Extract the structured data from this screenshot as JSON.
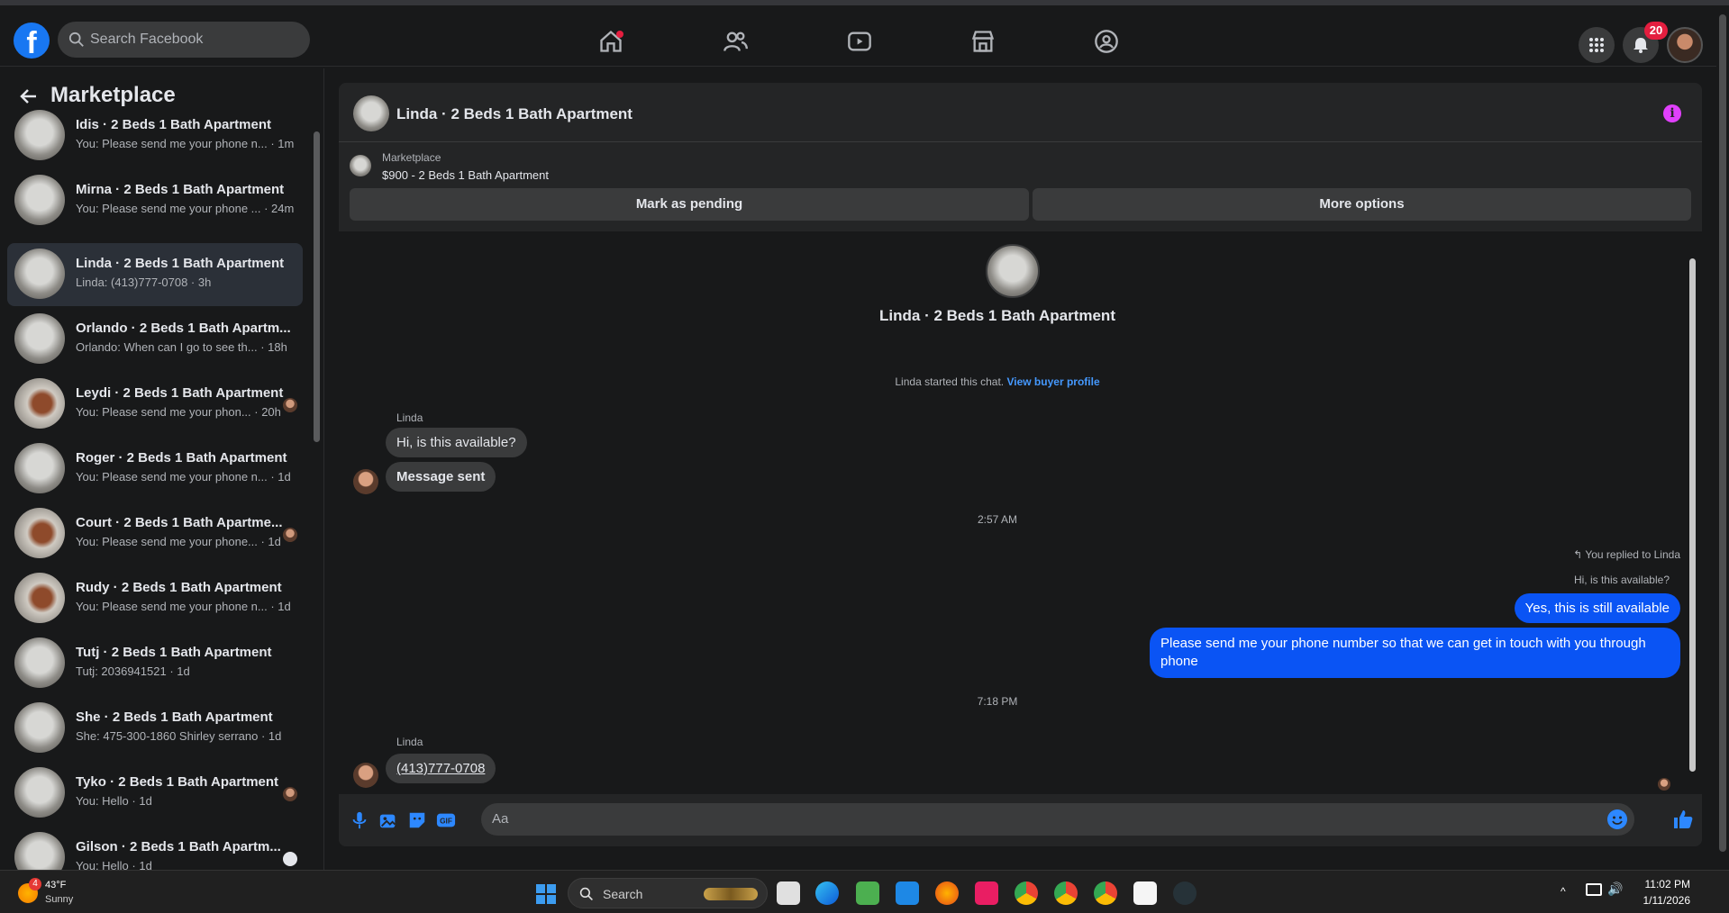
{
  "browser": {
    "url": "facebook.com/messages/t/"
  },
  "topnav": {
    "search_placeholder": "Search Facebook",
    "notification_count": "20",
    "icons": [
      "home-icon",
      "friends-icon",
      "watch-icon",
      "marketplace-icon",
      "groups-icon",
      "menu-grid-icon",
      "bell-icon"
    ]
  },
  "sidebar": {
    "title": "Marketplace",
    "conversations": [
      {
        "title": "Idis · 2 Beds 1 Bath Apartment",
        "preview": "You: Please send me your phone n... · 1m"
      },
      {
        "title": "Mirna · 2 Beds 1 Bath Apartment",
        "preview": "You: Please send me your phone ... · 24m"
      },
      {
        "title": "Linda · 2 Beds 1 Bath Apartment",
        "preview": "Linda: (413)777-0708 · 3h",
        "active": true
      },
      {
        "title": "Orlando · 2 Beds 1 Bath Apartm...",
        "preview": "Orlando: When can I go to see th... · 18h"
      },
      {
        "title": "Leydi · 2 Beds 1 Bath Apartment",
        "preview": "You: Please send me your phon... · 20h"
      },
      {
        "title": "Roger · 2 Beds 1 Bath Apartment",
        "preview": "You: Please send me your phone n... · 1d"
      },
      {
        "title": "Court · 2 Beds 1 Bath Apartme...",
        "preview": "You: Please send me your phone... · 1d"
      },
      {
        "title": "Rudy · 2 Beds 1 Bath Apartment",
        "preview": "You: Please send me your phone n... · 1d"
      },
      {
        "title": "Tutj · 2 Beds 1 Bath Apartment",
        "preview": "Tutj: 2036941521 · 1d"
      },
      {
        "title": "She · 2 Beds 1 Bath Apartment",
        "preview": "She: 475-300-1860 Shirley serrano · 1d"
      },
      {
        "title": "Tyko · 2 Beds 1 Bath Apartment",
        "preview": "You: Hello · 1d"
      },
      {
        "title": "Gilson · 2 Beds 1 Bath Apartm...",
        "preview": "You: Hello · 1d"
      }
    ]
  },
  "chat": {
    "header_title": "Linda · 2 Beds 1 Bath Apartment",
    "marketplace_label": "Marketplace",
    "listing_price": "$900 - 2 Beds 1 Bath Apartment",
    "mark_pending_label": "Mark as pending",
    "more_options_label": "More options",
    "center_name": "Linda · 2 Beds 1 Bath Apartment",
    "started_text": "Linda started this chat.",
    "view_profile_link": "View buyer profile",
    "messages": {
      "sender_1": "Linda",
      "in_1": "Hi, is this available?",
      "in_2": "Message sent",
      "time_1": "2:57 AM",
      "reply_note": "You replied to Linda",
      "reply_quote": "Hi, is this available?",
      "out_1": "Yes, this is still available",
      "out_2": "Please send me your phone  number so that we can get in touch with you through phone",
      "time_2": "7:18 PM",
      "sender_2": "Linda",
      "in_3": "(413)777-0708"
    },
    "composer_placeholder": "Aa"
  },
  "taskbar": {
    "weather_temp": "43°F",
    "weather_condition": "Sunny",
    "weather_badge": "4",
    "search_label": "Search",
    "time": "11:02 PM",
    "date": "1/11/2026"
  },
  "colors": {
    "brand": "#1877f2",
    "outgoing_bubble": "#0a54f4",
    "badge": "#e41e3f",
    "link": "#4599ff"
  }
}
